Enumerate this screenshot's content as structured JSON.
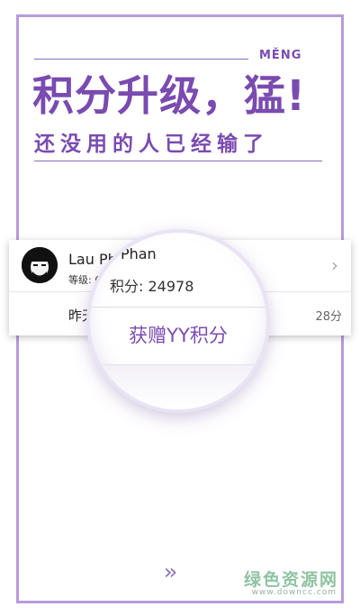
{
  "promo": {
    "pinyin": "MĚNG",
    "headline": "积分升级，猛!",
    "subline": "还没用的人已经输了"
  },
  "card": {
    "user_name": "Lau Phan",
    "level_text": "等级: 63",
    "row2_label": "昨天",
    "row2_points": "28分"
  },
  "magnifier": {
    "user_name": "Lau Phan",
    "points_text": "积分: 24978",
    "action_label": "获赠YY积分"
  },
  "nav": {
    "next_arrows": "››"
  },
  "watermark": {
    "cn": "绿色资源网",
    "en": "www.downcc.com"
  },
  "colors": {
    "accent": "#7a4bb0",
    "frame": "#b79bdb",
    "watermark": "#8fc3a2"
  }
}
